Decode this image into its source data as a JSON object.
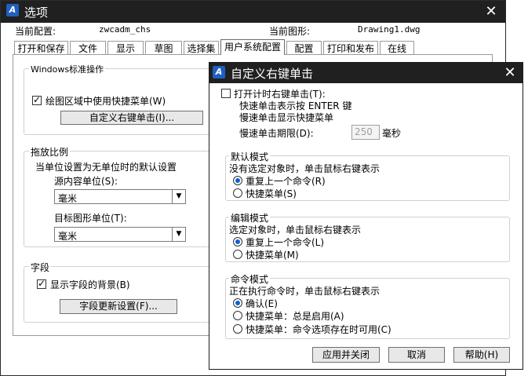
{
  "options": {
    "title": "选项",
    "current_profile_label": "当前配置:",
    "current_profile_value": "zwcadm_chs",
    "current_drawing_label": "当前图形:",
    "current_drawing_value": "Drawing1.dwg",
    "tabs": [
      "打开和保存",
      "文件",
      "显示",
      "草图",
      "选择集",
      "用户系统配置",
      "配置",
      "打印和发布",
      "在线"
    ],
    "active_tab": "用户系统配置",
    "windows_group": {
      "title": "Windows标准操作",
      "shortcut_menu_label": "绘图区域中使用快捷菜单(W)",
      "shortcut_menu_checked": true,
      "custom_right_click_button": "自定义右键单击(I)..."
    },
    "scale_group": {
      "title": "拖放比例",
      "subtitle": "当单位设置为无单位时的默认设置",
      "source_units_label": "源内容单位(S):",
      "source_units_value": "毫米",
      "target_units_label": "目标图形单位(T):",
      "target_units_value": "毫米"
    },
    "field_group": {
      "title": "字段",
      "show_background_label": "显示字段的背景(B)",
      "show_background_checked": true,
      "update_settings_button": "字段更新设置(F)..."
    }
  },
  "dialog": {
    "title": "自定义右键单击",
    "timer_label": "打开计时右键单击(T):",
    "timer_checked": false,
    "quick_click_text": "快速单击表示按 ENTER 键",
    "slow_click_text": "慢速单击显示快捷菜单",
    "slow_duration_label": "慢速单击期限(D):",
    "slow_duration_value": "250",
    "slow_duration_unit": "毫秒",
    "default_mode": {
      "title": "默认模式",
      "subtitle": "没有选定对象时，单击鼠标右键表示",
      "options": [
        "重复上一个命令(R)",
        "快捷菜单(S)"
      ],
      "selected": 0
    },
    "edit_mode": {
      "title": "编辑模式",
      "subtitle": "选定对象时，单击鼠标右键表示",
      "options": [
        "重复上一个命令(L)",
        "快捷菜单(M)"
      ],
      "selected": 0
    },
    "command_mode": {
      "title": "命令模式",
      "subtitle": "正在执行命令时，单击鼠标右键表示",
      "options": [
        "确认(E)",
        "快捷菜单：总是启用(A)",
        "快捷菜单：命令选项存在时可用(C)"
      ],
      "selected": 0
    },
    "apply_close_button": "应用并关闭",
    "cancel_button": "取消",
    "help_button": "帮助(H)"
  },
  "icons": {
    "app": "zwcad-logo-icon",
    "close": "close-icon",
    "dropdown": "chevron-down-icon"
  },
  "colors": {
    "titlebar": "#202020",
    "radio_selected": "#1060d0"
  }
}
